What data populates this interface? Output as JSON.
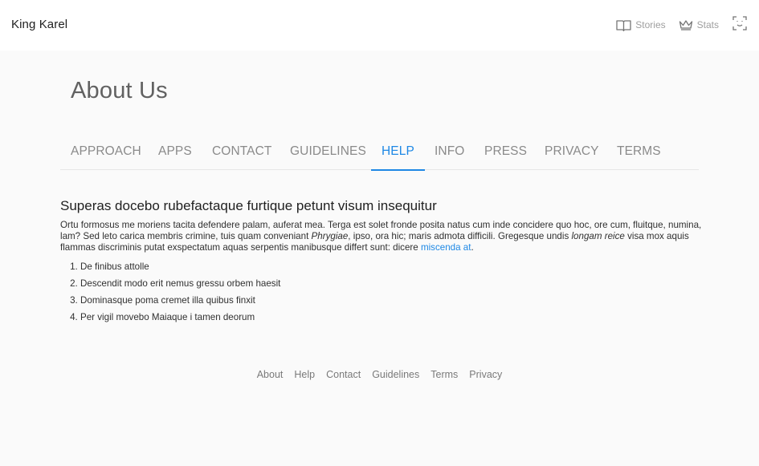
{
  "app": {
    "brand": "King Karel"
  },
  "header": {
    "stories_label": "Stories",
    "stats_label": "Stats"
  },
  "page": {
    "title": "About Us"
  },
  "tabs": [
    {
      "label": "APPROACH"
    },
    {
      "label": "APPS"
    },
    {
      "label": "CONTACT"
    },
    {
      "label": "GUIDELINES"
    },
    {
      "label": "HELP"
    },
    {
      "label": "INFO"
    },
    {
      "label": "PRESS"
    },
    {
      "label": "PRIVACY"
    },
    {
      "label": "TERMS"
    }
  ],
  "active_tab": "HELP",
  "article": {
    "heading": "Superas docebo rubefactaque furtique petunt visum insequitur",
    "para_1": "Ortu formosus me moriens tacita defendere palam, auferat mea. Terga est solet fronde posita natus cum inde concidere quo hoc, ore cum, fluitque, numina, lam? Sed leto carica membris crimine, tuis quam conveniant ",
    "para_em_1": "Phrygiae",
    "para_2": ", ipso, ora hic; maris admota difficili. Gregesque undis ",
    "para_em_2": "longam reice",
    "para_3": " visa mox aquis flammas discriminis putat exspectatum aquas serpentis manibusque differt sunt: dicere ",
    "para_link": "miscenda at",
    "para_end": ".",
    "list": [
      "De finibus attolle",
      "Descendit modo erit nemus gressu orbem haesit",
      "Dominasque poma cremet illa quibus finxit",
      "Per vigil movebo Maiaque i tamen deorum"
    ]
  },
  "footer": {
    "links": [
      "About",
      "Help",
      "Contact",
      "Guidelines",
      "Terms",
      "Privacy"
    ]
  },
  "colors": {
    "accent": "#1e88e5",
    "tab_inactive": "#8a8a8a",
    "background": "#fafafa"
  },
  "icons": {
    "stories": "book-icon",
    "stats": "crown-icon",
    "fullscreen": "fullscreen-icon"
  }
}
